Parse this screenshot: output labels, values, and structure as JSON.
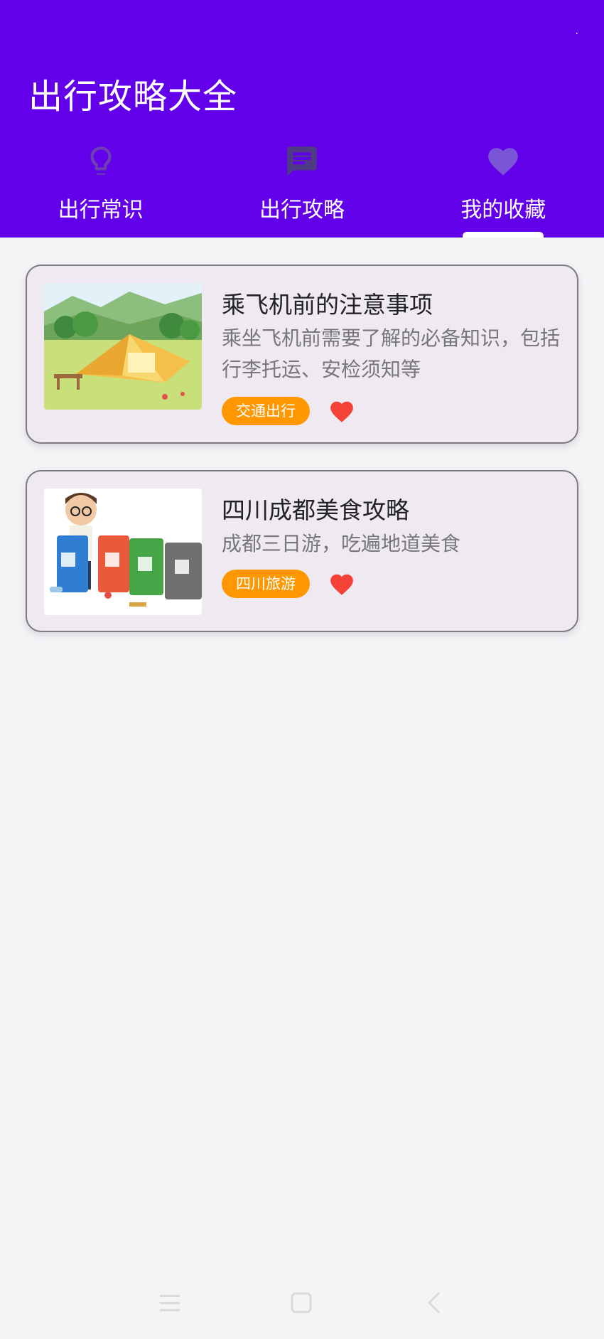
{
  "app": {
    "title": "出行攻略大全"
  },
  "colors": {
    "primary": "#6200ea",
    "accent": "#ff9800",
    "heart": "#f44336"
  },
  "tabs": [
    {
      "label": "出行常识",
      "icon": "lightbulb-icon",
      "selected": false
    },
    {
      "label": "出行攻略",
      "icon": "chat-icon",
      "selected": false
    },
    {
      "label": "我的收藏",
      "icon": "heart-icon",
      "selected": true
    }
  ],
  "favorites": [
    {
      "title": "乘飞机前的注意事项",
      "description": "乘坐飞机前需要了解的必备知识，包括行李托运、安检须知等",
      "tag": "交通出行",
      "image": "camping-tent-illustration",
      "favorited": true
    },
    {
      "title": "四川成都美食攻略",
      "description": "成都三日游，吃遍地道美食",
      "tag": "四川旅游",
      "image": "trash-sorting-illustration",
      "favorited": true
    }
  ],
  "navbar": {
    "icons": [
      "menu-icon",
      "home-icon",
      "back-icon"
    ]
  }
}
